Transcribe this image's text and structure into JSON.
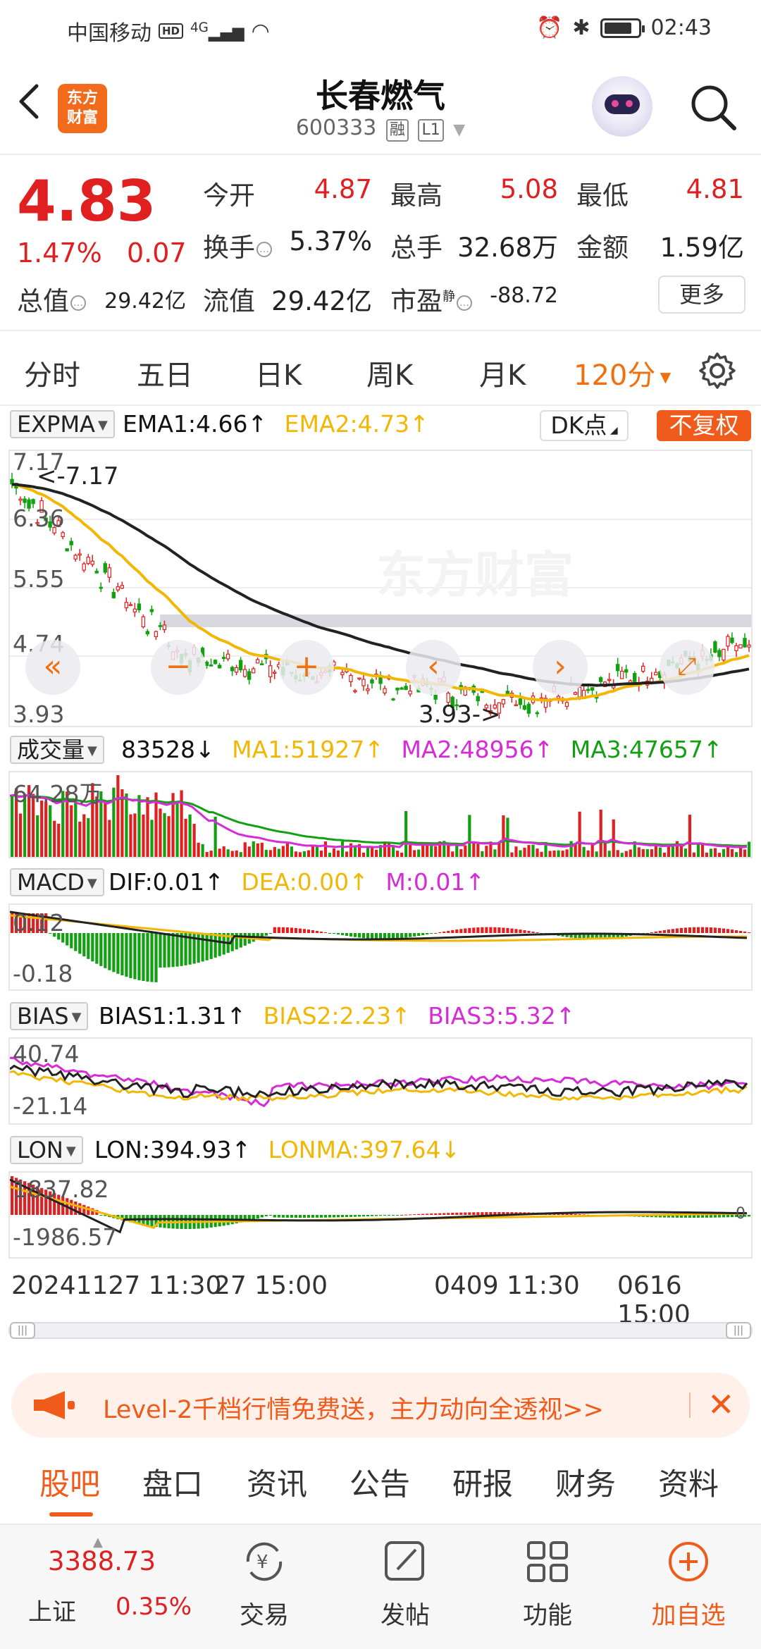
{
  "status_bar": {
    "carrier": "中国移动",
    "hd": "HD",
    "network": "4G",
    "time": "02:43"
  },
  "header": {
    "logo": "东方财富",
    "stock_name": "长春燃气",
    "stock_code": "600333",
    "tag_rong": "融",
    "tag_level": "L1"
  },
  "quote": {
    "price": "4.83",
    "change_pct": "1.47%",
    "change": "0.07",
    "open_label": "今开",
    "open": "4.87",
    "high_label": "最高",
    "high": "5.08",
    "low_label": "最低",
    "low": "4.81",
    "turnover_label": "换手",
    "turnover": "5.37%",
    "volume_label": "总手",
    "volume": "32.68万",
    "amount_label": "金额",
    "amount": "1.59亿",
    "total_cap_label": "总值",
    "total_cap": "29.42亿",
    "float_cap_label": "流值",
    "float_cap": "29.42亿",
    "pe_label": "市盈",
    "pe_sup": "静",
    "pe": "-88.72",
    "more": "更多"
  },
  "period_tabs": [
    "分时",
    "五日",
    "日K",
    "周K",
    "月K"
  ],
  "active_period": "120分",
  "expma": {
    "name": "EXPMA",
    "ema1": "EMA1:4.66↑",
    "ema2": "EMA2:4.73↑",
    "dk": "DK点",
    "fuquan": "不复权",
    "y_labels": [
      "7.17",
      "6.36",
      "5.55",
      "4.74",
      "3.93"
    ],
    "max_note": "<-7.17",
    "min_note": "3.93->",
    "watermark": "东方财富"
  },
  "volume": {
    "name": "成交量",
    "v": "83528↓",
    "ma1": "MA1:51927↑",
    "ma2": "MA2:48956↑",
    "ma3": "MA3:47657↑",
    "y_label": "64.28万"
  },
  "macd": {
    "name": "MACD",
    "dif": "DIF:0.01↑",
    "dea": "DEA:0.00↑",
    "m": "M:0.01↑",
    "y_top": "0.12",
    "y_bottom": "-0.18"
  },
  "bias": {
    "name": "BIAS",
    "b1": "BIAS1:1.31↑",
    "b2": "BIAS2:2.23↑",
    "b3": "BIAS3:5.32↑",
    "y_top": "40.74",
    "y_bottom": "-21.14"
  },
  "lon": {
    "name": "LON",
    "lon": "LON:394.93↑",
    "lonma": "LONMA:397.64↓",
    "y_top": "1837.82",
    "y_bottom": "-1986.57",
    "y_right": "0"
  },
  "x_dates": [
    "20241127 11:30",
    "27 15:00",
    "0409 11:30",
    "0616 15:00"
  ],
  "promo": {
    "text": "Level-2千档行情免费送，主力动向全透视>>"
  },
  "info_tabs": [
    "股吧",
    "盘口",
    "资讯",
    "公告",
    "研报",
    "财务",
    "资料"
  ],
  "bottom_nav": {
    "index_value": "3388.73",
    "index_name": "上证",
    "index_pct": "0.35%",
    "items": [
      "交易",
      "发帖",
      "功能",
      "加自选"
    ]
  },
  "colors": {
    "up": "#e02020",
    "accent": "#f05a1a",
    "ema1": "#111111",
    "ema2": "#f2b705",
    "ma2": "#d62bd6",
    "ma3": "#12a012"
  }
}
